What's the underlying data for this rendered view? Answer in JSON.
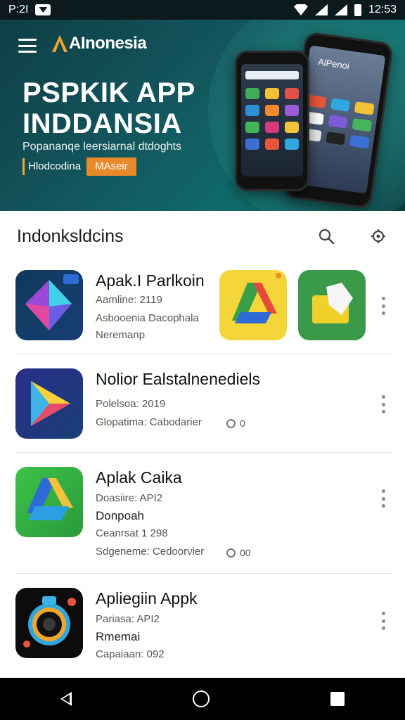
{
  "status_bar": {
    "left_text": "P:2I",
    "time": "12:53"
  },
  "header": {
    "brand": "AInonesia",
    "title_line1": "PSPKIK APP",
    "title_line2": "INDDANSIA",
    "subtitle": "Popananqe leersiarnal dtdoghts",
    "chip": "Hlodcodina",
    "cta": "MAseir"
  },
  "phone_screen_text": "AlPenoi",
  "section": {
    "title": "Indonksldcins"
  },
  "apps": [
    {
      "name": "Apak.I Parlkoin",
      "line1": "Aamline: 2119",
      "line2": "Asbooenia Dacophala",
      "line3": "Neremanp"
    },
    {
      "name": "Nolior Ealstalnenediels",
      "line1": "Polelsoa: 2019",
      "line2": "Glopatima: Cabodarier",
      "rating": "0"
    },
    {
      "name": "Aplak Caika",
      "line1": "Doasiire: API2",
      "line2": "Donpoah",
      "line3": "Ceanrsat 1 298",
      "line4": "Sdgeneme: Cedoorvier",
      "rating": "00"
    },
    {
      "name": "Apliegiin Appk",
      "line1": "Pariasa: API2",
      "line2": "Rmemai",
      "line3": "Capaiaan: 092"
    }
  ],
  "colors": {
    "hero_bg": "#13555d",
    "accent": "#e88a2a",
    "statusbar": "#0c1a1e"
  }
}
